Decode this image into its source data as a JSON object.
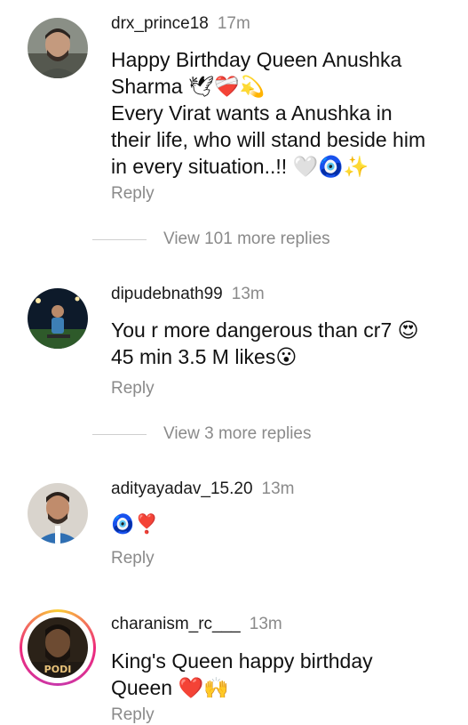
{
  "comments": [
    {
      "username": "drx_prince18",
      "time": "17m",
      "lines": [
        "Happy Birthday Queen Anushka",
        "Sharma 🕊❤️‍🩹💫",
        "Every Virat wants a Anushka in",
        "their life, who will stand beside him",
        "in every situation..!! 🤍🧿✨"
      ],
      "reply_label": "Reply",
      "view_more": "View 101 more replies"
    },
    {
      "username": "dipudebnath99",
      "time": "13m",
      "lines": [
        "You r more dangerous than cr7 😍",
        "45 min 3.5 M likes😮"
      ],
      "reply_label": "Reply",
      "view_more": "View 3 more replies"
    },
    {
      "username": "adityayadav_15.20",
      "time": "13m",
      "lines": [
        "🧿❣️"
      ],
      "reply_label": "Reply"
    },
    {
      "username": "charanism_rc___",
      "time": "13m",
      "lines": [
        "King's Queen happy birthday",
        "Queen ❤️🙌"
      ],
      "reply_label": "Reply",
      "avatar_text": "PODI"
    }
  ]
}
